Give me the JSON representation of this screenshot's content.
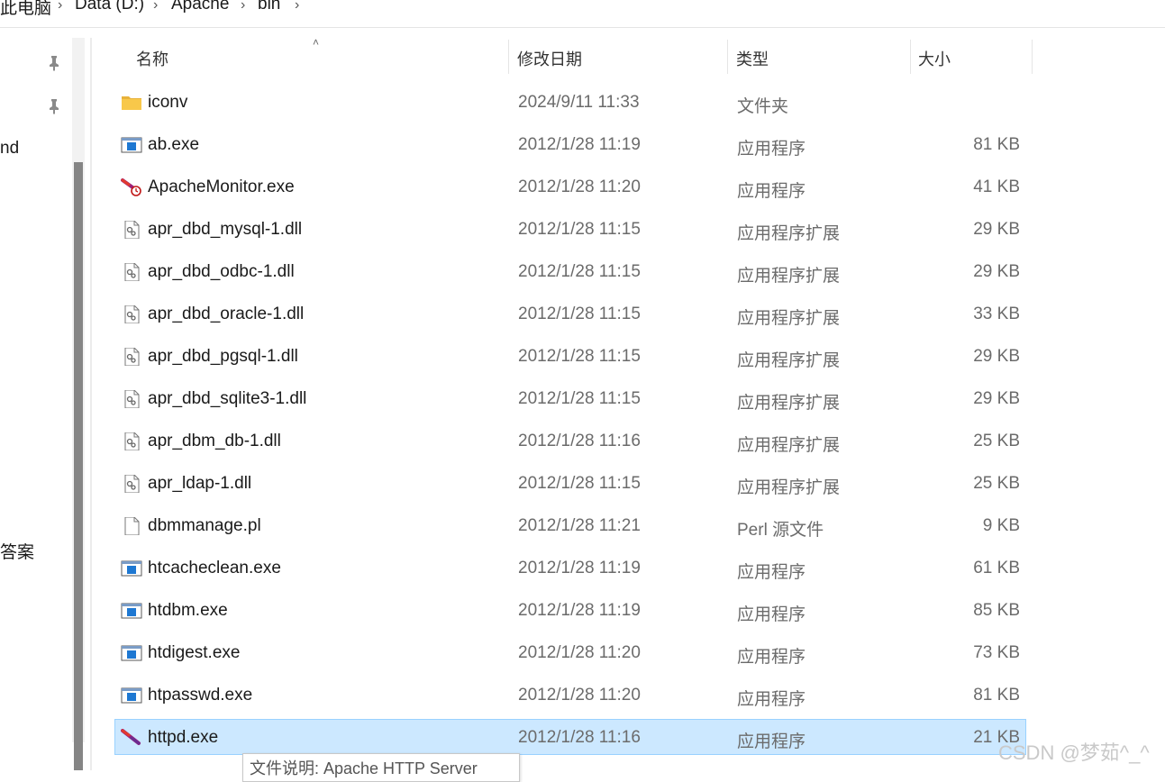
{
  "breadcrumb": {
    "items": [
      "此电脑",
      "Data (D:)",
      "Apache",
      "bin"
    ]
  },
  "nav": {
    "partial_items": [
      "nd",
      "答案"
    ]
  },
  "columns": {
    "name": "名称",
    "date": "修改日期",
    "type": "类型",
    "size": "大小"
  },
  "files": [
    {
      "name": "iconv",
      "date": "2024/9/11 11:33",
      "type": "文件夹",
      "size": "",
      "icon": "folder-icon"
    },
    {
      "name": "ab.exe",
      "date": "2012/1/28 11:19",
      "type": "应用程序",
      "size": "81 KB",
      "icon": "exe-icon"
    },
    {
      "name": "ApacheMonitor.exe",
      "date": "2012/1/28 11:20",
      "type": "应用程序",
      "size": "41 KB",
      "icon": "apache-monitor-icon"
    },
    {
      "name": "apr_dbd_mysql-1.dll",
      "date": "2012/1/28 11:15",
      "type": "应用程序扩展",
      "size": "29 KB",
      "icon": "dll-icon"
    },
    {
      "name": "apr_dbd_odbc-1.dll",
      "date": "2012/1/28 11:15",
      "type": "应用程序扩展",
      "size": "29 KB",
      "icon": "dll-icon"
    },
    {
      "name": "apr_dbd_oracle-1.dll",
      "date": "2012/1/28 11:15",
      "type": "应用程序扩展",
      "size": "33 KB",
      "icon": "dll-icon"
    },
    {
      "name": "apr_dbd_pgsql-1.dll",
      "date": "2012/1/28 11:15",
      "type": "应用程序扩展",
      "size": "29 KB",
      "icon": "dll-icon"
    },
    {
      "name": "apr_dbd_sqlite3-1.dll",
      "date": "2012/1/28 11:15",
      "type": "应用程序扩展",
      "size": "29 KB",
      "icon": "dll-icon"
    },
    {
      "name": "apr_dbm_db-1.dll",
      "date": "2012/1/28 11:16",
      "type": "应用程序扩展",
      "size": "25 KB",
      "icon": "dll-icon"
    },
    {
      "name": "apr_ldap-1.dll",
      "date": "2012/1/28 11:15",
      "type": "应用程序扩展",
      "size": "25 KB",
      "icon": "dll-icon"
    },
    {
      "name": "dbmmanage.pl",
      "date": "2012/1/28 11:21",
      "type": "Perl 源文件",
      "size": "9 KB",
      "icon": "file-icon"
    },
    {
      "name": "htcacheclean.exe",
      "date": "2012/1/28 11:19",
      "type": "应用程序",
      "size": "61 KB",
      "icon": "exe-icon"
    },
    {
      "name": "htdbm.exe",
      "date": "2012/1/28 11:19",
      "type": "应用程序",
      "size": "85 KB",
      "icon": "exe-icon"
    },
    {
      "name": "htdigest.exe",
      "date": "2012/1/28 11:20",
      "type": "应用程序",
      "size": "73 KB",
      "icon": "exe-icon"
    },
    {
      "name": "htpasswd.exe",
      "date": "2012/1/28 11:20",
      "type": "应用程序",
      "size": "81 KB",
      "icon": "exe-icon"
    },
    {
      "name": "httpd.exe",
      "date": "2012/1/28 11:16",
      "type": "应用程序",
      "size": "21 KB",
      "icon": "apache-feather-icon"
    }
  ],
  "tooltip": {
    "text": "文件说明: Apache HTTP Server"
  },
  "watermark": "CSDN @梦茹^_^",
  "colors": {
    "selected_bg": "#cce8ff",
    "selected_border": "#99d1ff",
    "folder": "#f8c84a",
    "exe_blue": "#1e78d2"
  }
}
